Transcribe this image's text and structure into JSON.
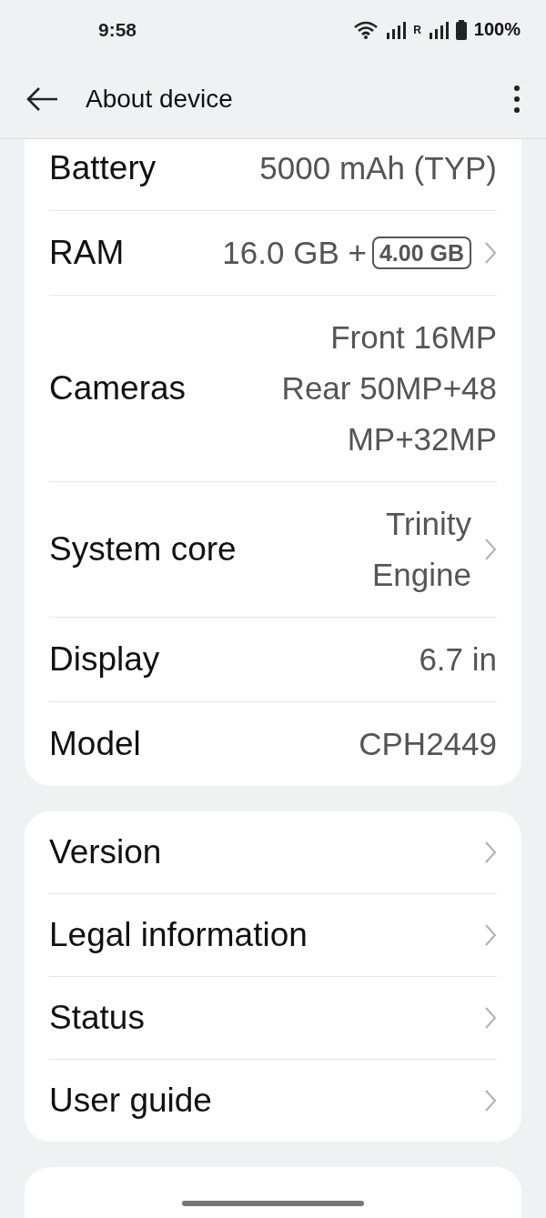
{
  "status_bar": {
    "time": "9:58",
    "roaming": "R",
    "battery": "100%"
  },
  "header": {
    "title": "About device"
  },
  "specs": [
    {
      "label": "Battery",
      "lines": [
        "5000 mAh (TYP)"
      ],
      "chevron": false
    },
    {
      "label": "RAM",
      "lines": [
        "16.0 GB +"
      ],
      "badge": "4.00 GB",
      "chevron": true
    },
    {
      "label": "Cameras",
      "lines": [
        "Front 16MP",
        "Rear 50MP+48",
        "MP+32MP"
      ],
      "chevron": false
    },
    {
      "label": "System core",
      "lines": [
        "Trinity",
        "Engine"
      ],
      "chevron": true
    },
    {
      "label": "Display",
      "lines": [
        "6.7 in"
      ],
      "chevron": false
    },
    {
      "label": "Model",
      "lines": [
        "CPH2449"
      ],
      "chevron": false
    }
  ],
  "links": [
    {
      "label": "Version",
      "chevron": true
    },
    {
      "label": "Legal information",
      "chevron": true
    },
    {
      "label": "Status",
      "chevron": true
    },
    {
      "label": "User guide",
      "chevron": true
    }
  ]
}
